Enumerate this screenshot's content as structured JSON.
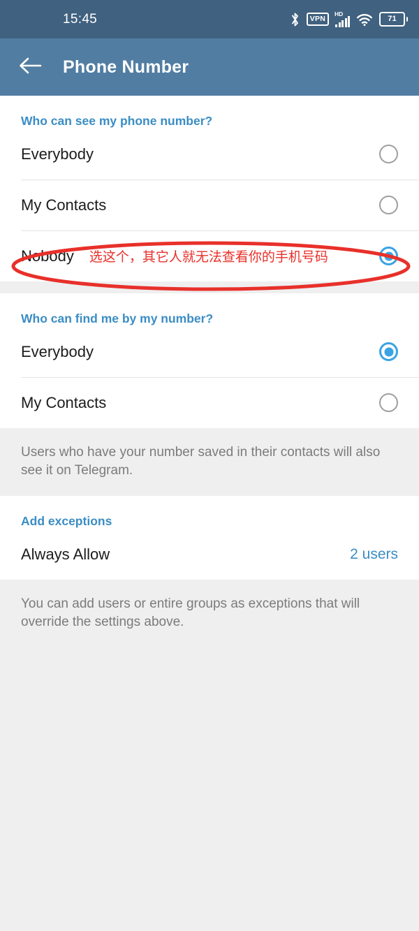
{
  "statusbar": {
    "time": "15:45",
    "icons": [
      {
        "name": "bluetooth-icon",
        "glyph": "ᛦ"
      },
      {
        "name": "vpn-icon",
        "label": "VPN"
      },
      {
        "name": "signal-icon",
        "label": "HD"
      },
      {
        "name": "wifi-icon",
        "label": ""
      },
      {
        "name": "battery-icon",
        "label": "71"
      }
    ],
    "battery_level": "71",
    "vpn_label": "VPN",
    "hd_label": "HD"
  },
  "appbar": {
    "title": "Phone Number",
    "back_icon": "back-arrow-icon"
  },
  "sections": [
    {
      "header": "Who can see my phone number?",
      "options": [
        {
          "label": "Everybody",
          "selected": false
        },
        {
          "label": "My Contacts",
          "selected": false
        },
        {
          "label": "Nobody",
          "selected": true
        }
      ]
    },
    {
      "header": "Who can find me by my number?",
      "options": [
        {
          "label": "Everybody",
          "selected": true
        },
        {
          "label": "My Contacts",
          "selected": false
        }
      ],
      "footnote": "Users who have your number saved in their contacts will also see it on Telegram."
    },
    {
      "header": "Add exceptions",
      "rows": [
        {
          "label": "Always Allow",
          "value": "2 users"
        }
      ],
      "footnote": "You can add users or entire groups as exceptions that will override the settings above."
    }
  ],
  "annotation": {
    "text": "选这个，其它人就无法查看你的手机号码",
    "color": "#e8302a",
    "shape": "ellipse-highlight"
  },
  "colors": {
    "statusbar_bg": "#40617f",
    "appbar_bg": "#517da2",
    "accent_blue": "#3b8dc4",
    "radio_on": "#3aa3e3",
    "radio_off": "#9e9e9e",
    "page_bg": "#efeff0",
    "annotation_red": "#e8302a"
  }
}
